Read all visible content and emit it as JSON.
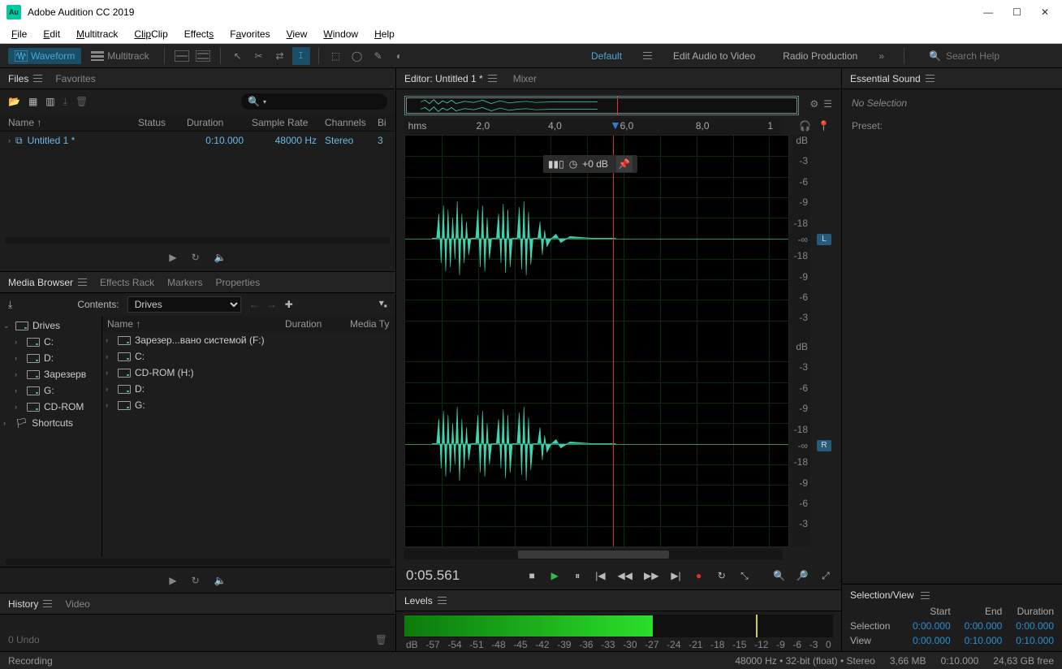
{
  "window": {
    "title": "Adobe Audition CC 2019"
  },
  "menu": [
    "File",
    "Edit",
    "Multitrack",
    "Clip",
    "Effects",
    "Favorites",
    "View",
    "Window",
    "Help"
  ],
  "workspace": {
    "waveform": "Waveform",
    "multitrack": "Multitrack",
    "default": "Default",
    "editAV": "Edit Audio to Video",
    "radio": "Radio Production",
    "searchPlaceholder": "Search Help"
  },
  "files": {
    "tabFiles": "Files",
    "tabFav": "Favorites",
    "cols": {
      "name": "Name ↑",
      "status": "Status",
      "duration": "Duration",
      "rate": "Sample Rate",
      "channels": "Channels",
      "bit": "Bi"
    },
    "row": {
      "name": "Untitled 1 *",
      "duration": "0:10.000",
      "rate": "48000 Hz",
      "channels": "Stereo",
      "bit": "3"
    }
  },
  "media": {
    "tabs": {
      "browser": "Media Browser",
      "fx": "Effects Rack",
      "markers": "Markers",
      "props": "Properties"
    },
    "contents": "Contents:",
    "drives": "Drives",
    "left": [
      "Drives",
      "C:",
      "D:",
      "Зарезерв",
      "G:",
      "CD-ROM",
      "Shortcuts"
    ],
    "list": {
      "hdrName": "Name ↑",
      "hdrDur": "Duration",
      "hdrType": "Media Ty"
    },
    "rows": [
      "Зарезер...вано системой (F:)",
      "C:",
      "CD-ROM (H:)",
      "D:",
      "G:"
    ]
  },
  "history": {
    "tab": "History",
    "video": "Video",
    "undo": "0 Undo"
  },
  "editor": {
    "tab": "Editor: Untitled 1 *",
    "mixer": "Mixer",
    "ruler": {
      "hms": "hms",
      "t2": "2,0",
      "t4": "4,0",
      "t6": "6,0",
      "t8": "8,0",
      "t10": "1"
    },
    "hud": "+0 dB",
    "db": {
      "dB": "dB",
      "m3": "-3",
      "m6": "-6",
      "m9": "-9",
      "m18": "-18",
      "inf": "-∞"
    },
    "ch": {
      "L": "L",
      "R": "R"
    },
    "timecode": "0:05.561"
  },
  "levels": {
    "tab": "Levels",
    "scale": [
      "dB",
      "-57",
      "-54",
      "-51",
      "-48",
      "-45",
      "-42",
      "-39",
      "-36",
      "-33",
      "-30",
      "-27",
      "-24",
      "-21",
      "-18",
      "-15",
      "-12",
      "-9",
      "-6",
      "-3",
      "0"
    ]
  },
  "ess": {
    "tab": "Essential Sound",
    "nosel": "No Selection",
    "preset": "Preset:"
  },
  "selview": {
    "tab": "Selection/View",
    "hdr": {
      "start": "Start",
      "end": "End",
      "dur": "Duration"
    },
    "sel": {
      "lbl": "Selection",
      "s": "0:00.000",
      "e": "0:00.000",
      "d": "0:00.000"
    },
    "view": {
      "lbl": "View",
      "s": "0:00.000",
      "e": "0:10.000",
      "d": "0:10.000"
    }
  },
  "status": {
    "recording": "Recording",
    "fmt": "48000 Hz • 32-bit (float) • Stereo",
    "size": "3,66 MB",
    "dur": "0:10.000",
    "free": "24,63 GB free"
  }
}
